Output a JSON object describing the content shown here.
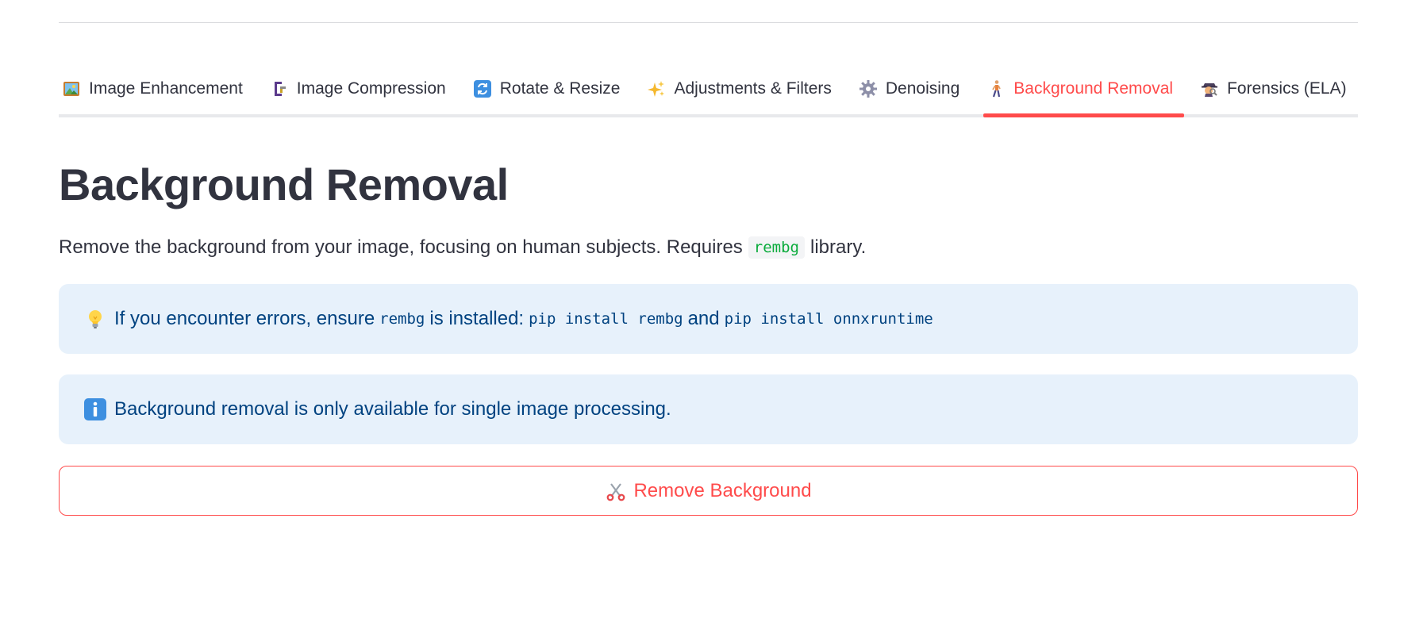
{
  "tabs": [
    {
      "label": "Image Enhancement",
      "icon": "framed-picture-icon",
      "active": false
    },
    {
      "label": "Image Compression",
      "icon": "clamp-icon",
      "active": false
    },
    {
      "label": "Rotate & Resize",
      "icon": "rotate-arrows-icon",
      "active": false
    },
    {
      "label": "Adjustments & Filters",
      "icon": "sparkles-icon",
      "active": false
    },
    {
      "label": "Denoising",
      "icon": "gear-icon",
      "active": false
    },
    {
      "label": "Background Removal",
      "icon": "person-walking-icon",
      "active": true
    },
    {
      "label": "Forensics (ELA)",
      "icon": "detective-icon",
      "active": false
    }
  ],
  "page": {
    "title": "Background Removal",
    "description_before": "Remove the background from your image, focusing on human subjects. Requires",
    "description_code": "rembg",
    "description_after": "library."
  },
  "alerts": {
    "install": {
      "icon": "light-bulb-icon",
      "text_1": "If you encounter errors, ensure",
      "code_1": "rembg",
      "text_2": "is installed:",
      "code_2": "pip install rembg",
      "text_3": "and",
      "code_3": "pip install onnxruntime"
    },
    "info": {
      "icon": "information-icon",
      "text": "Background removal is only available for single image processing."
    }
  },
  "button": {
    "icon": "scissors-icon",
    "label": "Remove Background"
  },
  "colors": {
    "accent": "#ff4b4b",
    "alert_bg": "#e7f1fb",
    "alert_text": "#004280",
    "text": "#31333f",
    "code_green": "#09ab3b"
  }
}
